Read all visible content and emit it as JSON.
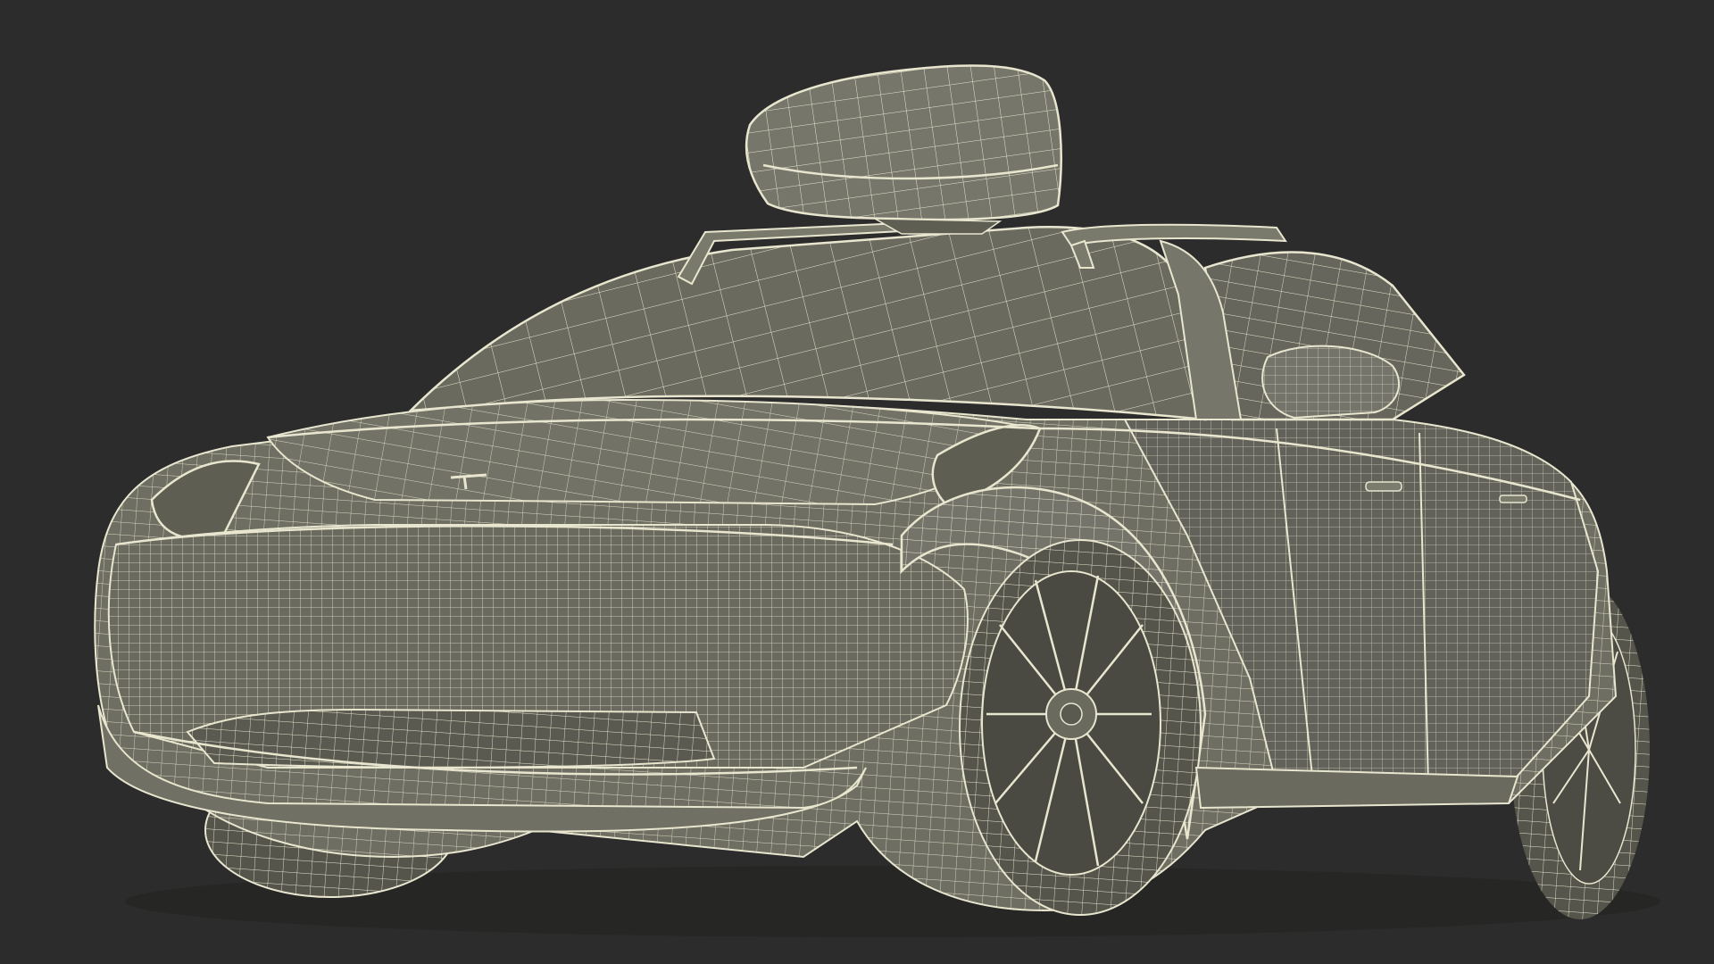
{
  "scene": {
    "subject": "wireframe-car-with-roof-box",
    "render_style": "wireframe",
    "colors": {
      "background": "#2c2c2c",
      "surface": "#6e6e62",
      "surface_dark": "#5e5e53",
      "surface_light": "#7b7b6e",
      "wire": "#e8e6cf",
      "tire": "#55554c",
      "shadow": "#3a3a36"
    }
  }
}
